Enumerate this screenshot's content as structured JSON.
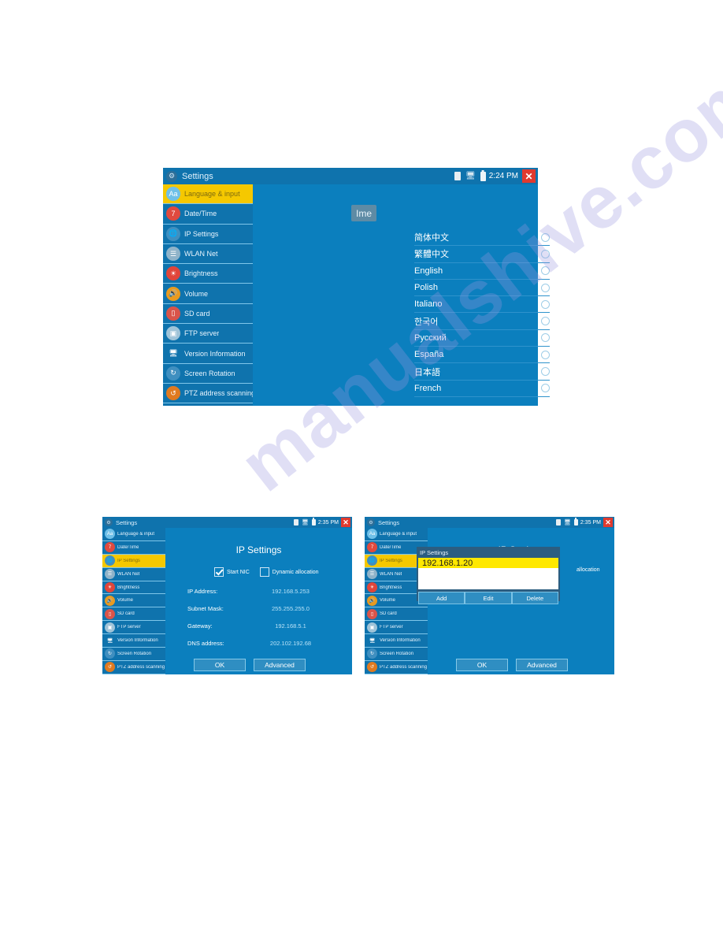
{
  "watermark": {
    "text": "manualshive.com"
  },
  "screens": {
    "language": {
      "titlebar": {
        "app_icon": "gear-icon",
        "title": "Settings",
        "time": "2:24 PM",
        "close_label": "✕",
        "icons": [
          "sim-card-icon",
          "network-icon",
          "battery-icon"
        ]
      },
      "sidebar": [
        {
          "label": "Language & input",
          "icon": "aa-icon",
          "active": true
        },
        {
          "label": "Date/Time",
          "icon": "calendar-icon",
          "active": false
        },
        {
          "label": "IP Settings",
          "icon": "globe-icon",
          "active": false
        },
        {
          "label": "WLAN Net",
          "icon": "wifi-icon",
          "active": false
        },
        {
          "label": "Brightness",
          "icon": "brightness-icon",
          "active": false
        },
        {
          "label": "Volume",
          "icon": "speaker-icon",
          "active": false
        },
        {
          "label": "SD card",
          "icon": "sd-card-icon",
          "active": false
        },
        {
          "label": "FTP server",
          "icon": "server-icon",
          "active": false
        },
        {
          "label": "Version Information",
          "icon": "monitor-icon",
          "active": false
        },
        {
          "label": "Screen Rotation",
          "icon": "rotate-icon",
          "active": false
        },
        {
          "label": "PTZ address scanning",
          "icon": "ptz-scan-icon",
          "active": false
        }
      ],
      "tab": {
        "label": "Ime"
      },
      "languages": [
        "简体中文",
        "繁體中文",
        "English",
        "Polish",
        "Italiano",
        "한국어",
        "Русский",
        "España",
        "日本語",
        "French"
      ]
    },
    "ip_settings": {
      "titlebar": {
        "app_icon": "gear-icon",
        "title": "Settings",
        "time": "2:35 PM",
        "close_label": "✕"
      },
      "sidebar": [
        {
          "label": "Language & input",
          "icon": "aa-icon",
          "active": false
        },
        {
          "label": "Date/Time",
          "icon": "calendar-icon",
          "active": false
        },
        {
          "label": "IP Settings",
          "icon": "globe-icon",
          "active": true
        },
        {
          "label": "WLAN Net",
          "icon": "wifi-icon",
          "active": false
        },
        {
          "label": "Brightness",
          "icon": "brightness-icon",
          "active": false
        },
        {
          "label": "Volume",
          "icon": "speaker-icon",
          "active": false
        },
        {
          "label": "SD card",
          "icon": "sd-card-icon",
          "active": false
        },
        {
          "label": "FTP server",
          "icon": "server-icon",
          "active": false
        },
        {
          "label": "Version Information",
          "icon": "monitor-icon",
          "active": false
        },
        {
          "label": "Screen Rotation",
          "icon": "rotate-icon",
          "active": false
        },
        {
          "label": "PTZ address scanning",
          "icon": "ptz-scan-icon",
          "active": false
        }
      ],
      "title": "IP Settings",
      "checkboxes": {
        "start_nic": {
          "label": "Start NIC",
          "checked": true
        },
        "dynamic": {
          "label": "Dynamic allocation",
          "checked": false
        }
      },
      "fields": [
        {
          "label": "IP Address:",
          "value": "192.168.5.253"
        },
        {
          "label": "Subnet Mask:",
          "value": "255.255.255.0"
        },
        {
          "label": "Gateway:",
          "value": "192.168.5.1"
        },
        {
          "label": "DNS address:",
          "value": "202.102.192.68"
        }
      ],
      "buttons": {
        "ok": "OK",
        "advanced": "Advanced"
      }
    },
    "ip_dialog": {
      "titlebar": {
        "app_icon": "gear-icon",
        "title": "Settings",
        "time": "2:35 PM",
        "close_label": "✕"
      },
      "title": "IP Settings",
      "partial_label": "allocation",
      "dialog": {
        "title": "IP Settings",
        "entries": [
          "192.168.1.20"
        ],
        "buttons": [
          "Add",
          "Edit",
          "Delete"
        ]
      },
      "buttons": {
        "ok": "OK",
        "advanced": "Advanced"
      }
    }
  },
  "colors": {
    "pane_blue": "#0b7fbe",
    "sidebar_blue": "#0f73ad",
    "accent_yellow": "#f5c800",
    "row_yellow": "#ffe800",
    "close_red": "#e03a2f",
    "dialog_navy": "#2c5d80"
  }
}
